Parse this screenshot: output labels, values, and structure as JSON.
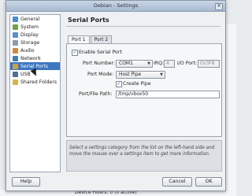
{
  "window": {
    "title": "Debian - Settings"
  },
  "sidebar": {
    "items": [
      {
        "label": "General",
        "icon": "general-icon",
        "color": "#4a8bd6"
      },
      {
        "label": "System",
        "icon": "chip-icon",
        "color": "#6fa34a"
      },
      {
        "label": "Display",
        "icon": "monitor-icon",
        "color": "#5b8fc8"
      },
      {
        "label": "Storage",
        "icon": "disk-icon",
        "color": "#8a9bb0"
      },
      {
        "label": "Audio",
        "icon": "speaker-icon",
        "color": "#d08a3a"
      },
      {
        "label": "Network",
        "icon": "network-icon",
        "color": "#3f7fb5"
      },
      {
        "label": "Serial Ports",
        "icon": "serial-port-icon",
        "color": "#c9a23f",
        "selected": true
      },
      {
        "label": "USB",
        "icon": "usb-icon",
        "color": "#4c6f95"
      },
      {
        "label": "Shared Folders",
        "icon": "folder-icon",
        "color": "#d9b347"
      }
    ]
  },
  "panel": {
    "title": "Serial Ports",
    "tabs": [
      {
        "label": "Port 1",
        "active": true
      },
      {
        "label": "Port 2",
        "active": false
      }
    ],
    "enable_label": "Enable Serial Port",
    "enable_checked": true,
    "port_number_label": "Port Number:",
    "port_number_value": "COM1",
    "irq_label": "IRQ:",
    "irq_value": "4",
    "io_port_label": "I/O Port:",
    "io_port_value": "0x3F8",
    "port_mode_label": "Port Mode:",
    "port_mode_value": "Host Pipe",
    "create_pipe_label": "Create Pipe",
    "create_pipe_checked": true,
    "path_label": "Port/File Path:",
    "path_value": "/tmp/vbox50"
  },
  "info_text": "Select a settings category from the list on the left-hand side and move the mouse over a settings item to get more information.",
  "buttons": {
    "help": "Help",
    "cancel": "Cancel",
    "ok": "OK"
  },
  "background": {
    "device_filters": "Device Filters: 0 (0 active)"
  }
}
